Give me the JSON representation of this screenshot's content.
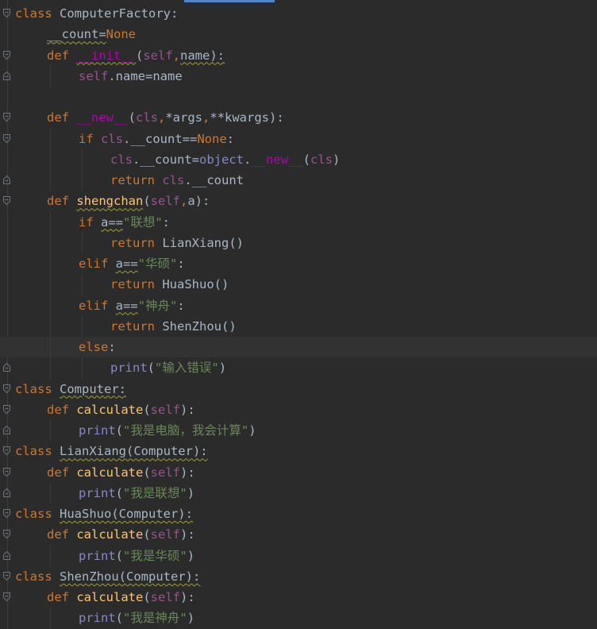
{
  "editor": {
    "lines": [
      {
        "indent": 0,
        "fold": "open",
        "tokens": [
          {
            "t": "class ",
            "c": "kw"
          },
          {
            "t": "ComputerFactory:",
            "c": "name"
          }
        ]
      },
      {
        "indent": 1,
        "fold": "",
        "tokens": [
          {
            "t": "__count=",
            "c": "name"
          },
          {
            "t": "None",
            "c": "kw"
          }
        ]
      },
      {
        "indent": 1,
        "fold": "open",
        "tokens": [
          {
            "t": "def ",
            "c": "kw"
          },
          {
            "t": "__init__",
            "c": "magic"
          },
          {
            "t": "(",
            "c": "name"
          },
          {
            "t": "self",
            "c": "self"
          },
          {
            "t": ",",
            "c": "kw"
          },
          {
            "t": "name):",
            "c": "name"
          }
        ]
      },
      {
        "indent": 2,
        "fold": "close",
        "tokens": [
          {
            "t": "self",
            "c": "self"
          },
          {
            "t": ".name=name",
            "c": "name"
          }
        ]
      },
      {
        "indent": 0,
        "fold": "",
        "tokens": []
      },
      {
        "indent": 1,
        "fold": "open",
        "tokens": [
          {
            "t": "def ",
            "c": "kw"
          },
          {
            "t": "__new__",
            "c": "magic"
          },
          {
            "t": "(",
            "c": "name"
          },
          {
            "t": "cls",
            "c": "self"
          },
          {
            "t": ",",
            "c": "kw"
          },
          {
            "t": "*args",
            "c": "name"
          },
          {
            "t": ",",
            "c": "kw"
          },
          {
            "t": "**kwargs):",
            "c": "name"
          }
        ]
      },
      {
        "indent": 2,
        "fold": "open",
        "tokens": [
          {
            "t": "if ",
            "c": "kw"
          },
          {
            "t": "cls",
            "c": "self"
          },
          {
            "t": ".__count==",
            "c": "name"
          },
          {
            "t": "None",
            "c": "kw"
          },
          {
            "t": ":",
            "c": "name"
          }
        ]
      },
      {
        "indent": 3,
        "fold": "",
        "tokens": [
          {
            "t": "cls",
            "c": "self"
          },
          {
            "t": ".__count=",
            "c": "name"
          },
          {
            "t": "object",
            "c": "builtin"
          },
          {
            "t": ".",
            "c": "name"
          },
          {
            "t": "__new__",
            "c": "magic"
          },
          {
            "t": "(",
            "c": "name"
          },
          {
            "t": "cls",
            "c": "self"
          },
          {
            "t": ")",
            "c": "name"
          }
        ]
      },
      {
        "indent": 3,
        "fold": "close",
        "tokens": [
          {
            "t": "return ",
            "c": "kw"
          },
          {
            "t": "cls",
            "c": "self"
          },
          {
            "t": ".__count",
            "c": "name"
          }
        ]
      },
      {
        "indent": 1,
        "fold": "open",
        "tokens": [
          {
            "t": "def ",
            "c": "kw"
          },
          {
            "t": "shengchan",
            "c": "fn"
          },
          {
            "t": "(",
            "c": "name"
          },
          {
            "t": "self",
            "c": "self"
          },
          {
            "t": ",",
            "c": "kw"
          },
          {
            "t": "a):",
            "c": "name"
          }
        ]
      },
      {
        "indent": 2,
        "fold": "",
        "tokens": [
          {
            "t": "if ",
            "c": "kw"
          },
          {
            "t": "a==",
            "c": "name"
          },
          {
            "t": "\"联想\"",
            "c": "str"
          },
          {
            "t": ":",
            "c": "name"
          }
        ]
      },
      {
        "indent": 3,
        "fold": "",
        "tokens": [
          {
            "t": "return ",
            "c": "kw"
          },
          {
            "t": "LianXiang()",
            "c": "name"
          }
        ]
      },
      {
        "indent": 2,
        "fold": "",
        "tokens": [
          {
            "t": "elif ",
            "c": "kw"
          },
          {
            "t": "a==",
            "c": "name"
          },
          {
            "t": "\"华硕\"",
            "c": "str"
          },
          {
            "t": ":",
            "c": "name"
          }
        ]
      },
      {
        "indent": 3,
        "fold": "",
        "tokens": [
          {
            "t": "return ",
            "c": "kw"
          },
          {
            "t": "HuaShuo()",
            "c": "name"
          }
        ]
      },
      {
        "indent": 2,
        "fold": "",
        "tokens": [
          {
            "t": "elif ",
            "c": "kw"
          },
          {
            "t": "a==",
            "c": "name"
          },
          {
            "t": "\"神舟\"",
            "c": "str"
          },
          {
            "t": ":",
            "c": "name"
          }
        ]
      },
      {
        "indent": 3,
        "fold": "",
        "tokens": [
          {
            "t": "return ",
            "c": "kw"
          },
          {
            "t": "ShenZhou()",
            "c": "name"
          }
        ]
      },
      {
        "indent": 2,
        "fold": "",
        "current": true,
        "tokens": [
          {
            "t": "else",
            "c": "kw"
          },
          {
            "t": ":",
            "c": "name"
          }
        ]
      },
      {
        "indent": 3,
        "fold": "close",
        "tokens": [
          {
            "t": "print",
            "c": "builtin"
          },
          {
            "t": "(",
            "c": "name"
          },
          {
            "t": "\"输入错误\"",
            "c": "str"
          },
          {
            "t": ")",
            "c": "name"
          }
        ]
      },
      {
        "indent": 0,
        "fold": "open",
        "tokens": [
          {
            "t": "class ",
            "c": "kw"
          },
          {
            "t": "Computer:",
            "c": "name"
          }
        ]
      },
      {
        "indent": 1,
        "fold": "open",
        "tokens": [
          {
            "t": "def ",
            "c": "kw"
          },
          {
            "t": "calculate",
            "c": "fn"
          },
          {
            "t": "(",
            "c": "name"
          },
          {
            "t": "self",
            "c": "self"
          },
          {
            "t": "):",
            "c": "name"
          }
        ]
      },
      {
        "indent": 2,
        "fold": "close",
        "tokens": [
          {
            "t": "print",
            "c": "builtin"
          },
          {
            "t": "(",
            "c": "name"
          },
          {
            "t": "\"我是电脑，我会计算\"",
            "c": "str"
          },
          {
            "t": ")",
            "c": "name"
          }
        ]
      },
      {
        "indent": 0,
        "fold": "open",
        "tokens": [
          {
            "t": "class ",
            "c": "kw"
          },
          {
            "t": "LianXiang(Computer):",
            "c": "name"
          }
        ]
      },
      {
        "indent": 1,
        "fold": "open",
        "tokens": [
          {
            "t": "def ",
            "c": "kw"
          },
          {
            "t": "calculate",
            "c": "fn"
          },
          {
            "t": "(",
            "c": "name"
          },
          {
            "t": "self",
            "c": "self"
          },
          {
            "t": "):",
            "c": "name"
          }
        ]
      },
      {
        "indent": 2,
        "fold": "close",
        "tokens": [
          {
            "t": "print",
            "c": "builtin"
          },
          {
            "t": "(",
            "c": "name"
          },
          {
            "t": "\"我是联想\"",
            "c": "str"
          },
          {
            "t": ")",
            "c": "name"
          }
        ]
      },
      {
        "indent": 0,
        "fold": "open",
        "tokens": [
          {
            "t": "class ",
            "c": "kw"
          },
          {
            "t": "HuaShuo(Computer):",
            "c": "name"
          }
        ]
      },
      {
        "indent": 1,
        "fold": "open",
        "tokens": [
          {
            "t": "def ",
            "c": "kw"
          },
          {
            "t": "calculate",
            "c": "fn"
          },
          {
            "t": "(",
            "c": "name"
          },
          {
            "t": "self",
            "c": "self"
          },
          {
            "t": "):",
            "c": "name"
          }
        ]
      },
      {
        "indent": 2,
        "fold": "close",
        "tokens": [
          {
            "t": "print",
            "c": "builtin"
          },
          {
            "t": "(",
            "c": "name"
          },
          {
            "t": "\"我是华硕\"",
            "c": "str"
          },
          {
            "t": ")",
            "c": "name"
          }
        ]
      },
      {
        "indent": 0,
        "fold": "open",
        "tokens": [
          {
            "t": "class ",
            "c": "kw"
          },
          {
            "t": "ShenZhou(Computer):",
            "c": "name"
          }
        ]
      },
      {
        "indent": 1,
        "fold": "open",
        "tokens": [
          {
            "t": "def ",
            "c": "kw"
          },
          {
            "t": "calculate",
            "c": "fn"
          },
          {
            "t": "(",
            "c": "name"
          },
          {
            "t": "self",
            "c": "self"
          },
          {
            "t": "):",
            "c": "name"
          }
        ]
      },
      {
        "indent": 2,
        "fold": "",
        "tokens": [
          {
            "t": "print",
            "c": "builtin"
          },
          {
            "t": "(",
            "c": "name"
          },
          {
            "t": "\"我是神舟\"",
            "c": "str"
          },
          {
            "t": ")",
            "c": "name"
          }
        ]
      }
    ]
  }
}
